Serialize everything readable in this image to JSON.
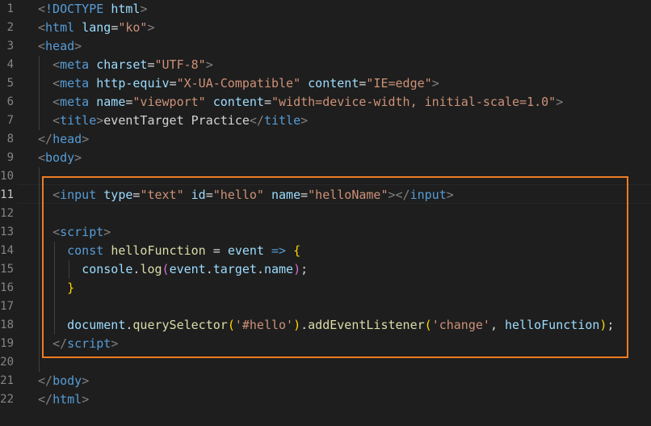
{
  "editor": {
    "active_line": 11,
    "highlight_color": "#ee7b22",
    "lines": [
      {
        "n": "1",
        "tokens": [
          [
            "br",
            "<"
          ],
          [
            "tag",
            "!DOCTYPE"
          ],
          [
            "txt",
            " "
          ],
          [
            "attr",
            "html"
          ],
          [
            "br",
            ">"
          ]
        ]
      },
      {
        "n": "2",
        "tokens": [
          [
            "br",
            "<"
          ],
          [
            "tag",
            "html"
          ],
          [
            "txt",
            " "
          ],
          [
            "attr",
            "lang"
          ],
          [
            "txt",
            "="
          ],
          [
            "str",
            "\"ko\""
          ],
          [
            "br",
            ">"
          ]
        ]
      },
      {
        "n": "3",
        "tokens": [
          [
            "br",
            "<"
          ],
          [
            "tag",
            "head"
          ],
          [
            "br",
            ">"
          ]
        ]
      },
      {
        "n": "4",
        "tokens": [
          [
            "txt",
            "  "
          ],
          [
            "br",
            "<"
          ],
          [
            "tag",
            "meta"
          ],
          [
            "txt",
            " "
          ],
          [
            "attr",
            "charset"
          ],
          [
            "txt",
            "="
          ],
          [
            "str",
            "\"UTF-8\""
          ],
          [
            "br",
            ">"
          ]
        ]
      },
      {
        "n": "5",
        "tokens": [
          [
            "txt",
            "  "
          ],
          [
            "br",
            "<"
          ],
          [
            "tag",
            "meta"
          ],
          [
            "txt",
            " "
          ],
          [
            "attr",
            "http-equiv"
          ],
          [
            "txt",
            "="
          ],
          [
            "str",
            "\"X-UA-Compatible\""
          ],
          [
            "txt",
            " "
          ],
          [
            "attr",
            "content"
          ],
          [
            "txt",
            "="
          ],
          [
            "str",
            "\"IE=edge\""
          ],
          [
            "br",
            ">"
          ]
        ]
      },
      {
        "n": "6",
        "tokens": [
          [
            "txt",
            "  "
          ],
          [
            "br",
            "<"
          ],
          [
            "tag",
            "meta"
          ],
          [
            "txt",
            " "
          ],
          [
            "attr",
            "name"
          ],
          [
            "txt",
            "="
          ],
          [
            "str",
            "\"viewport\""
          ],
          [
            "txt",
            " "
          ],
          [
            "attr",
            "content"
          ],
          [
            "txt",
            "="
          ],
          [
            "str",
            "\"width=device-width, initial-scale=1.0\""
          ],
          [
            "br",
            ">"
          ]
        ]
      },
      {
        "n": "7",
        "tokens": [
          [
            "txt",
            "  "
          ],
          [
            "br",
            "<"
          ],
          [
            "tag",
            "title"
          ],
          [
            "br",
            ">"
          ],
          [
            "txt",
            "eventTarget Practice"
          ],
          [
            "br",
            "</"
          ],
          [
            "tag",
            "title"
          ],
          [
            "br",
            ">"
          ]
        ]
      },
      {
        "n": "8",
        "tokens": [
          [
            "br",
            "</"
          ],
          [
            "tag",
            "head"
          ],
          [
            "br",
            ">"
          ]
        ]
      },
      {
        "n": "9",
        "tokens": [
          [
            "br",
            "<"
          ],
          [
            "tag",
            "body"
          ],
          [
            "br",
            ">"
          ]
        ]
      },
      {
        "n": "10",
        "tokens": []
      },
      {
        "n": "11",
        "tokens": [
          [
            "txt",
            "  "
          ],
          [
            "br",
            "<"
          ],
          [
            "tag",
            "input"
          ],
          [
            "txt",
            " "
          ],
          [
            "attr",
            "type"
          ],
          [
            "txt",
            "="
          ],
          [
            "str",
            "\"text\""
          ],
          [
            "txt",
            " "
          ],
          [
            "attr",
            "id"
          ],
          [
            "txt",
            "="
          ],
          [
            "str",
            "\"hello\""
          ],
          [
            "txt",
            " "
          ],
          [
            "attr",
            "name"
          ],
          [
            "txt",
            "="
          ],
          [
            "str",
            "\"helloName\""
          ],
          [
            "br",
            "></"
          ],
          [
            "tag",
            "input"
          ],
          [
            "br",
            ">"
          ]
        ]
      },
      {
        "n": "12",
        "tokens": []
      },
      {
        "n": "13",
        "tokens": [
          [
            "txt",
            "  "
          ],
          [
            "br",
            "<"
          ],
          [
            "tag",
            "script"
          ],
          [
            "br",
            ">"
          ]
        ]
      },
      {
        "n": "14",
        "tokens": [
          [
            "txt",
            "    "
          ],
          [
            "kw",
            "const"
          ],
          [
            "txt",
            " "
          ],
          [
            "fn",
            "helloFunction"
          ],
          [
            "txt",
            " = "
          ],
          [
            "var",
            "event"
          ],
          [
            "txt",
            " "
          ],
          [
            "kw",
            "=>"
          ],
          [
            "txt",
            " "
          ],
          [
            "p1",
            "{"
          ]
        ]
      },
      {
        "n": "15",
        "tokens": [
          [
            "txt",
            "      "
          ],
          [
            "var",
            "console"
          ],
          [
            "txt",
            "."
          ],
          [
            "fn",
            "log"
          ],
          [
            "p2",
            "("
          ],
          [
            "var",
            "event"
          ],
          [
            "txt",
            "."
          ],
          [
            "var",
            "target"
          ],
          [
            "txt",
            "."
          ],
          [
            "var",
            "name"
          ],
          [
            "p2",
            ")"
          ],
          [
            "txt",
            ";"
          ]
        ]
      },
      {
        "n": "16",
        "tokens": [
          [
            "txt",
            "    "
          ],
          [
            "p1",
            "}"
          ]
        ]
      },
      {
        "n": "17",
        "tokens": []
      },
      {
        "n": "18",
        "tokens": [
          [
            "txt",
            "    "
          ],
          [
            "var",
            "document"
          ],
          [
            "txt",
            "."
          ],
          [
            "fn",
            "querySelector"
          ],
          [
            "p1",
            "("
          ],
          [
            "str",
            "'#hello'"
          ],
          [
            "p1",
            ")"
          ],
          [
            "txt",
            "."
          ],
          [
            "fn",
            "addEventListener"
          ],
          [
            "p1",
            "("
          ],
          [
            "str",
            "'change'"
          ],
          [
            "txt",
            ", "
          ],
          [
            "var",
            "helloFunction"
          ],
          [
            "p1",
            ")"
          ],
          [
            "txt",
            ";"
          ]
        ]
      },
      {
        "n": "19",
        "tokens": [
          [
            "txt",
            "  "
          ],
          [
            "br",
            "</"
          ],
          [
            "tag",
            "script"
          ],
          [
            "br",
            ">"
          ]
        ]
      },
      {
        "n": "20",
        "tokens": []
      },
      {
        "n": "21",
        "tokens": [
          [
            "br",
            "</"
          ],
          [
            "tag",
            "body"
          ],
          [
            "br",
            ">"
          ]
        ]
      },
      {
        "n": "22",
        "tokens": [
          [
            "br",
            "</"
          ],
          [
            "tag",
            "html"
          ],
          [
            "br",
            ">"
          ]
        ]
      }
    ]
  }
}
